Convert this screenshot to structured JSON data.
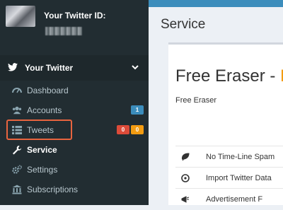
{
  "sidebar": {
    "user_label": "Your Twitter ID:",
    "menu_header": "Your Twitter",
    "items": [
      {
        "label": "Dashboard"
      },
      {
        "label": "Accounts",
        "badge": "1",
        "badge_color": "#3c8dbc"
      },
      {
        "label": "Tweets",
        "badges": [
          "0",
          "0"
        ],
        "badge_colors": [
          "#dd4b39",
          "#f39c12"
        ]
      },
      {
        "label": "Service"
      },
      {
        "label": "Settings"
      },
      {
        "label": "Subscriptions"
      }
    ]
  },
  "content": {
    "page_title": "Service",
    "panel_title": "Free Eraser - ",
    "panel_title_accent": "F",
    "panel_subtitle": "Free Eraser",
    "features": [
      {
        "text": "No Time-Line Spam",
        "icon": "leaf-icon"
      },
      {
        "text": "Import Twitter Data",
        "icon": "info-circle-icon"
      },
      {
        "text": "Advertisement F",
        "icon": "bullhorn-icon"
      }
    ]
  },
  "colors": {
    "sidebar_bg": "#222d32",
    "header_bg": "#1e282c",
    "content_bg": "#ecf0f5",
    "accent_orange": "#f39c12",
    "highlight": "#e8643f"
  }
}
